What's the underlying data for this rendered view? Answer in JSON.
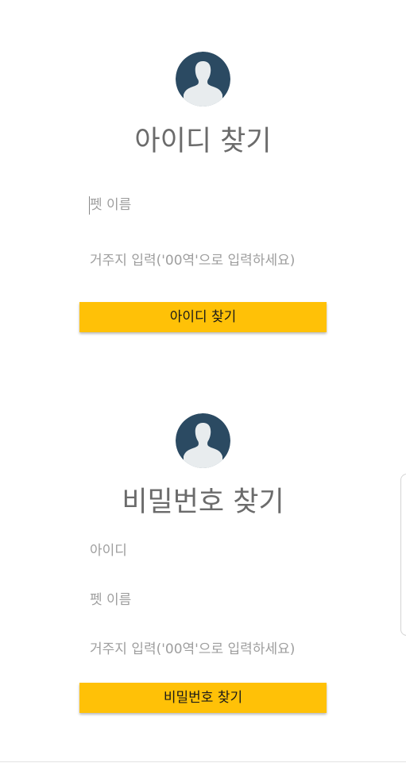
{
  "find_id": {
    "title": "아이디 찾기",
    "pet_name_placeholder": "펫 이름",
    "address_placeholder": "거주지 입력('00역'으로 입력하세요)",
    "button_label": "아이디 찾기"
  },
  "find_password": {
    "title": "비밀번호 찾기",
    "id_placeholder": "아이디",
    "pet_name_placeholder": "펫 이름",
    "address_placeholder": "거주지 입력('00역'으로 입력하세요)",
    "button_label": "비밀번호 찾기"
  },
  "icons": {
    "avatar": "user-avatar-icon"
  },
  "colors": {
    "accent": "#ffc107",
    "avatar_bg": "#2b4a62",
    "avatar_figure": "#e8ecee",
    "title_text": "#6b6b6b",
    "placeholder_text": "#9e9e9e"
  }
}
